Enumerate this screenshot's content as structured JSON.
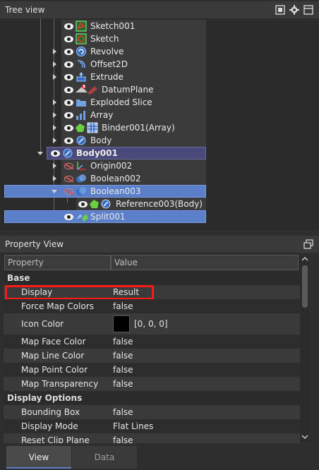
{
  "tree_view": {
    "title": "Tree view",
    "items": [
      {
        "label": "Sketch001"
      },
      {
        "label": "Sketch"
      },
      {
        "label": "Revolve"
      },
      {
        "label": "Offset2D"
      },
      {
        "label": "Extrude"
      },
      {
        "label": "DatumPlane"
      },
      {
        "label": "Exploded Slice"
      },
      {
        "label": "Array"
      },
      {
        "label": "Binder001(Array)"
      },
      {
        "label": "Body"
      },
      {
        "label": "Body001"
      },
      {
        "label": "Origin002"
      },
      {
        "label": "Boolean002"
      },
      {
        "label": "Boolean003"
      },
      {
        "label": "Reference003(Body)"
      },
      {
        "label": "Split001"
      }
    ]
  },
  "property_view": {
    "title": "Property View",
    "col_property": "Property",
    "col_value": "Value",
    "groups": {
      "base": "Base",
      "display_options": "Display Options"
    },
    "rows": [
      {
        "name": "Display",
        "value": "Result"
      },
      {
        "name": "Force Map Colors",
        "value": "false"
      },
      {
        "name": "Icon Color",
        "value": "[0, 0, 0]"
      },
      {
        "name": "Map Face Color",
        "value": "false"
      },
      {
        "name": "Map Line Color",
        "value": "false"
      },
      {
        "name": "Map Point Color",
        "value": "false"
      },
      {
        "name": "Map Transparency",
        "value": "false"
      },
      {
        "name": "Bounding Box",
        "value": "false"
      },
      {
        "name": "Display Mode",
        "value": "Flat Lines"
      },
      {
        "name": "Reset Clip Plane",
        "value": "false"
      }
    ]
  },
  "tabs": {
    "view": "View",
    "data": "Data"
  },
  "colors": {
    "selection": "#5b7fc9",
    "highlight_border": "#ff0000",
    "icon_color_swatch": "#000000"
  }
}
